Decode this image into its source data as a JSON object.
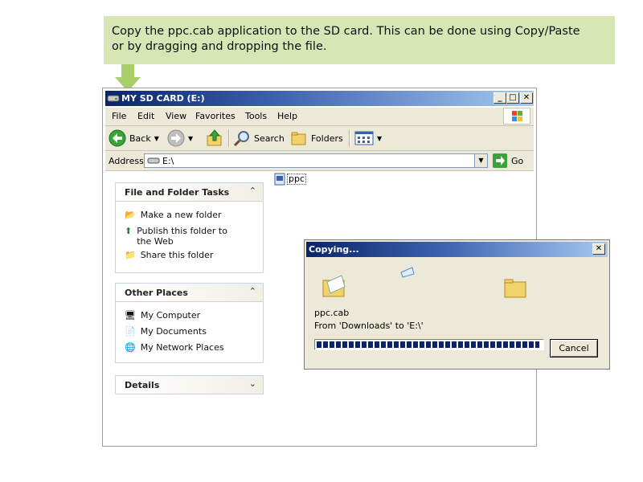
{
  "instruction": {
    "line1": "Copy the ppc.cab application to the SD card. This can be done using Copy/Paste",
    "line2": "or by dragging and dropping the file."
  },
  "window": {
    "title": "MY SD CARD (E:)",
    "menu": [
      "File",
      "Edit",
      "View",
      "Favorites",
      "Tools",
      "Help"
    ],
    "toolbar": {
      "back": "Back",
      "search": "Search",
      "folders": "Folders"
    },
    "address": {
      "label": "Address",
      "value": "E:\\",
      "go": "Go"
    }
  },
  "taskpane": {
    "file_tasks": {
      "title": "File and Folder Tasks",
      "items": [
        "Make a new folder",
        "Publish this folder to the Web",
        "Share this folder"
      ]
    },
    "other_places": {
      "title": "Other Places",
      "items": [
        "My Computer",
        "My Documents",
        "My Network Places"
      ]
    },
    "details": {
      "title": "Details"
    }
  },
  "files": [
    {
      "name": "ppc"
    }
  ],
  "copy_dialog": {
    "title": "Copying...",
    "filename": "ppc.cab",
    "from_text": "From 'Downloads' to 'E:\\'",
    "progress": 0.99,
    "cancel": "Cancel"
  },
  "colors": {
    "callout_bg": "#d6e6b4",
    "titlebar": "#0a246a",
    "progress": "#0a246a"
  }
}
